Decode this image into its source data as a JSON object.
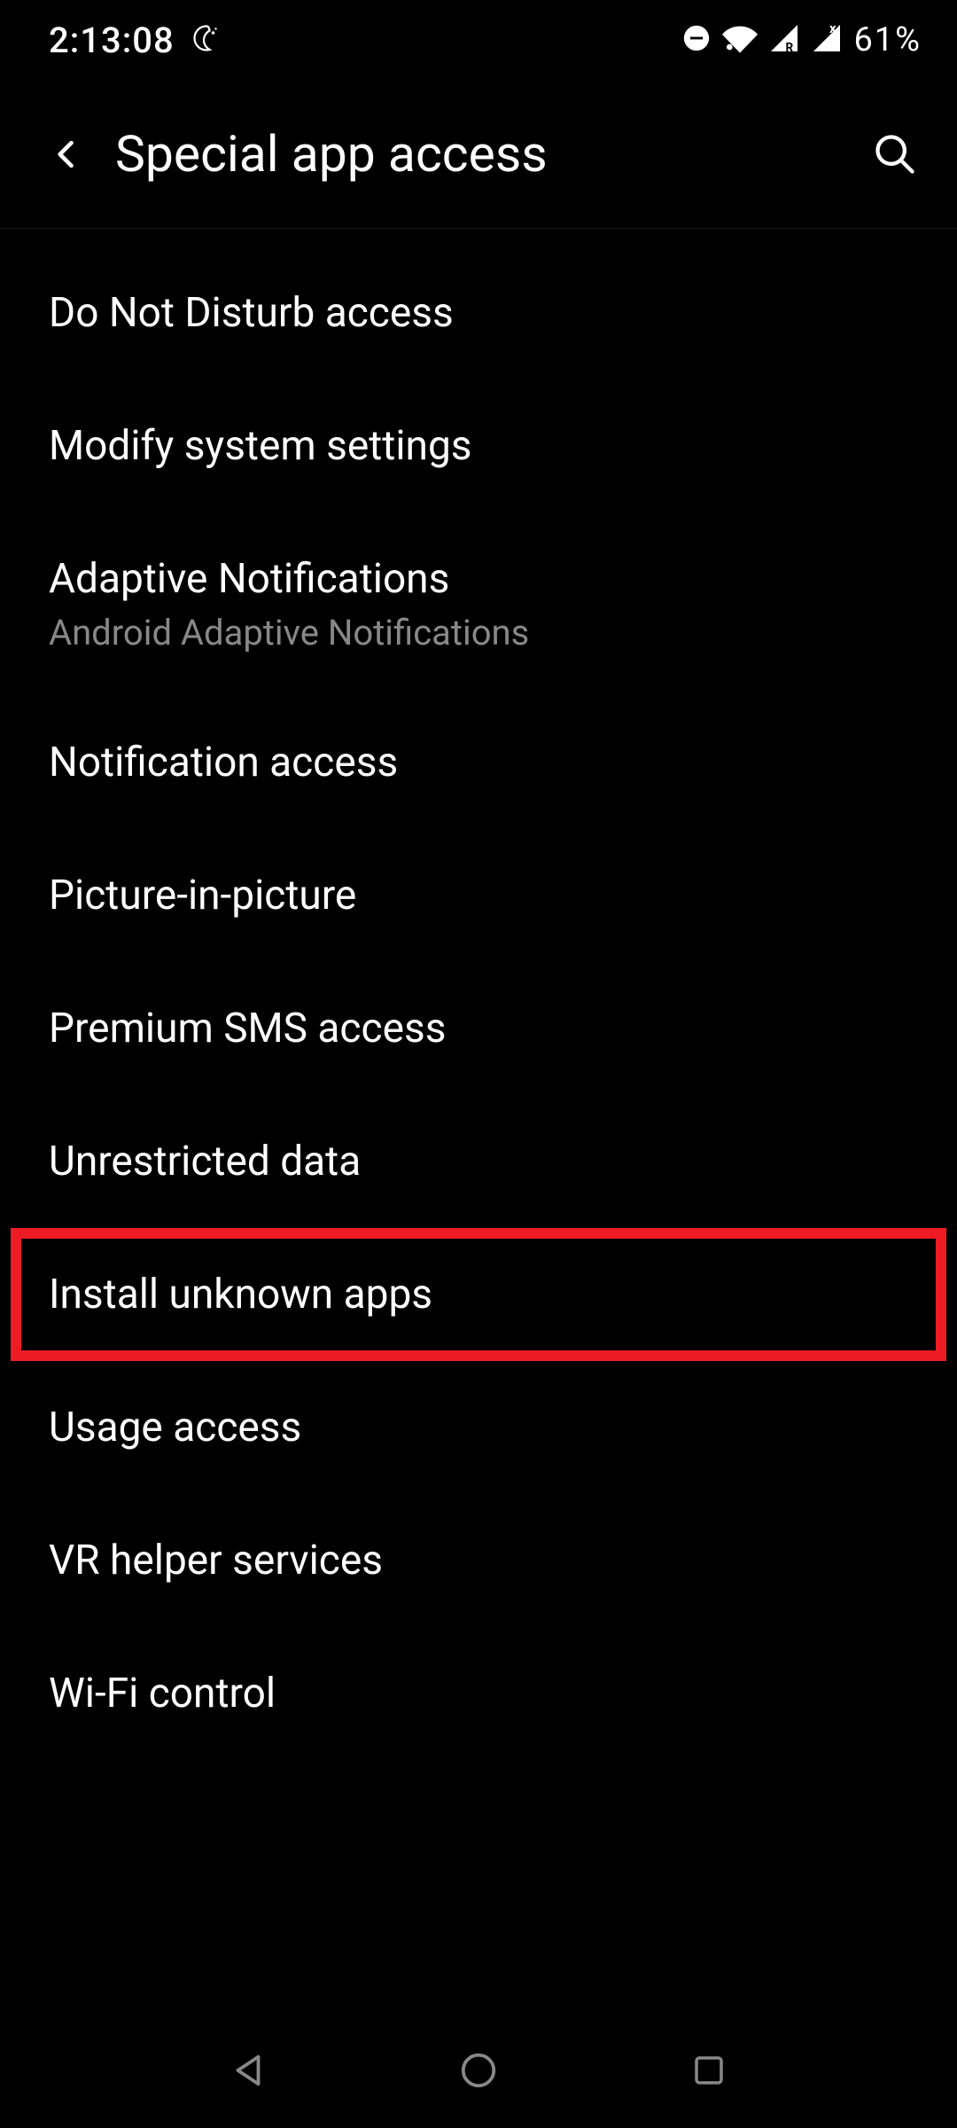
{
  "status": {
    "time": "2:13:08",
    "battery": "61%"
  },
  "header": {
    "title": "Special app access"
  },
  "items": [
    {
      "label": "Do Not Disturb access",
      "sublabel": null
    },
    {
      "label": "Modify system settings",
      "sublabel": null
    },
    {
      "label": "Adaptive Notifications",
      "sublabel": "Android Adaptive Notifications"
    },
    {
      "label": "Notification access",
      "sublabel": null
    },
    {
      "label": "Picture-in-picture",
      "sublabel": null
    },
    {
      "label": "Premium SMS access",
      "sublabel": null
    },
    {
      "label": "Unrestricted data",
      "sublabel": null
    },
    {
      "label": "Install unknown apps",
      "sublabel": null,
      "highlighted": true
    },
    {
      "label": "Usage access",
      "sublabel": null
    },
    {
      "label": "VR helper services",
      "sublabel": null
    },
    {
      "label": "Wi-Fi control",
      "sublabel": null
    }
  ]
}
